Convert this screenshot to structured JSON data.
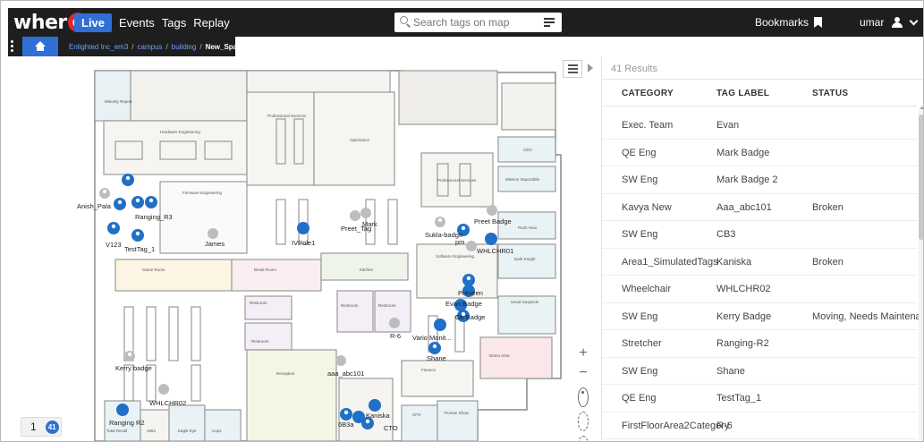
{
  "app": {
    "logo": "wher",
    "logo_e": "e",
    "nav": [
      {
        "label": "Live",
        "active": true
      },
      {
        "label": "Events",
        "active": false
      },
      {
        "label": "Tags",
        "active": false
      },
      {
        "label": "Replay",
        "active": false
      }
    ],
    "search": {
      "placeholder": "Search tags on map"
    },
    "bookmarks_label": "Bookmarks",
    "user_name": "umar"
  },
  "breadcrumb": {
    "items": [
      "Enlighted Inc_em3",
      "campus",
      "building"
    ],
    "current": "New_Space"
  },
  "map": {
    "rooms": [
      "Minority Report",
      "Hardware Engineering",
      "Professional Services",
      "Operations",
      "CEO",
      "Mission Impossible",
      "Rush Hour",
      "Dark Knight",
      "Usual Suspects",
      "Demo Area",
      "Firmware Engineering",
      "Professional Services",
      "Software Engineering",
      "Game Room",
      "Break Room",
      "Kitchen",
      "Restroom",
      "Restroom",
      "Restroom",
      "Restroom",
      "Reception",
      "Finance",
      "CFO",
      "Truman Show",
      "Total Recall",
      "1984",
      "Eagle Eye",
      "Cops"
    ],
    "tags": [
      "Anish_Pala",
      "Ranging_R3",
      "V123",
      "TestTag_1",
      "James",
      "IVPole1",
      "Preet_Tag",
      "Mark",
      "Sukla-badge",
      "pm",
      "Preet Badge",
      "WHLCHR01",
      "Preveen",
      "Evan Badge",
      "Ok Badge",
      "R-6",
      "Vario Monit...",
      "Shane",
      "Kerry badge",
      "aaa_abc101",
      "WHLCHR02",
      "Ranging R2",
      "6B3a",
      "Kaniska",
      "CTO"
    ],
    "floor_number": "1",
    "floor_badge": "41",
    "accent": "#2f6fd6"
  },
  "results": {
    "count_label": "41 Results",
    "headers": [
      "CATEGORY",
      "TAG LABEL",
      "STATUS"
    ],
    "rows": [
      {
        "category": "Exec. Team",
        "tag": "Evan",
        "status": ""
      },
      {
        "category": "QE Eng",
        "tag": "Mark Badge",
        "status": ""
      },
      {
        "category": "SW Eng",
        "tag": "Mark Badge 2",
        "status": ""
      },
      {
        "category": "Kavya New",
        "tag": "Aaa_abc101",
        "status": "Broken"
      },
      {
        "category": "SW Eng",
        "tag": "CB3",
        "status": ""
      },
      {
        "category": "Area1_SimulatedTags",
        "tag": "Kaniska",
        "status": "Broken"
      },
      {
        "category": "Wheelchair",
        "tag": "WHLCHR02",
        "status": ""
      },
      {
        "category": "SW Eng",
        "tag": "Kerry Badge",
        "status": "Moving, Needs Maintenance"
      },
      {
        "category": "Stretcher",
        "tag": "Ranging-R2",
        "status": ""
      },
      {
        "category": "SW Eng",
        "tag": "Shane",
        "status": ""
      },
      {
        "category": "QE Eng",
        "tag": "TestTag_1",
        "status": ""
      },
      {
        "category": "FirstFloorArea2Category",
        "tag": "R-6",
        "status": ""
      }
    ]
  }
}
